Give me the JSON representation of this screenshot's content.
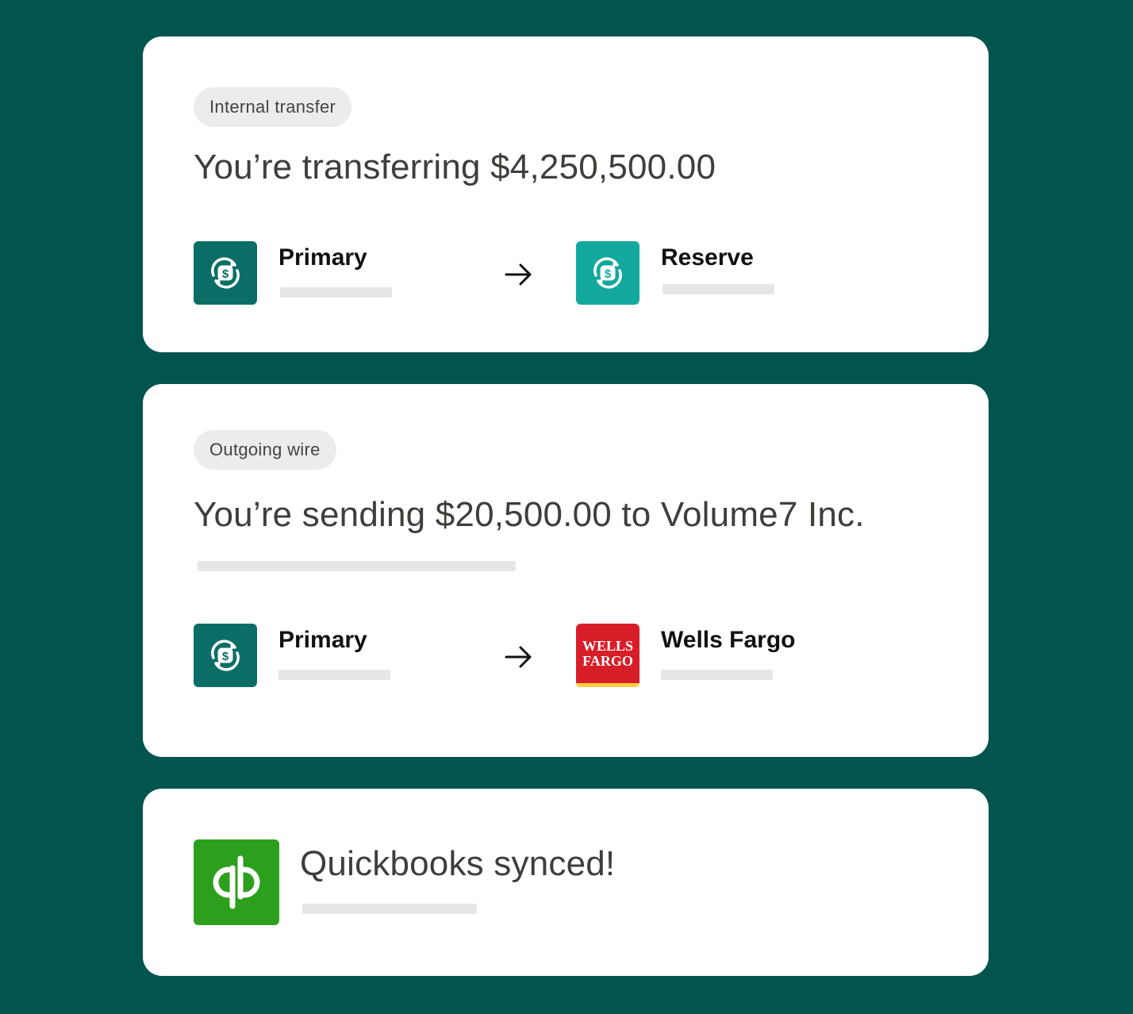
{
  "cards": [
    {
      "tag": "Internal transfer",
      "headline": "You’re transferring $4,250,500.00",
      "from": {
        "name": "Primary",
        "icon": "dollar-sync-icon",
        "icon_color": "#0b6e66"
      },
      "to": {
        "name": "Reserve",
        "icon": "dollar-sync-icon",
        "icon_color": "#13a89e"
      }
    },
    {
      "tag": "Outgoing wire",
      "headline": "You’re sending $20,500.00 to Volume7 Inc.",
      "from": {
        "name": "Primary",
        "icon": "dollar-sync-icon",
        "icon_color": "#0b6e66"
      },
      "to": {
        "name": "Wells Fargo",
        "icon": "wells-fargo-logo",
        "logo_text": "WELLS FARGO",
        "icon_color": "#d71e28"
      }
    },
    {
      "headline": "Quickbooks synced!",
      "icon": "quickbooks-logo",
      "icon_color": "#2ca01c"
    }
  ],
  "colors": {
    "background": "#02544f",
    "card": "#ffffff",
    "pill": "#ececec",
    "placeholder": "#e6e6e6"
  }
}
